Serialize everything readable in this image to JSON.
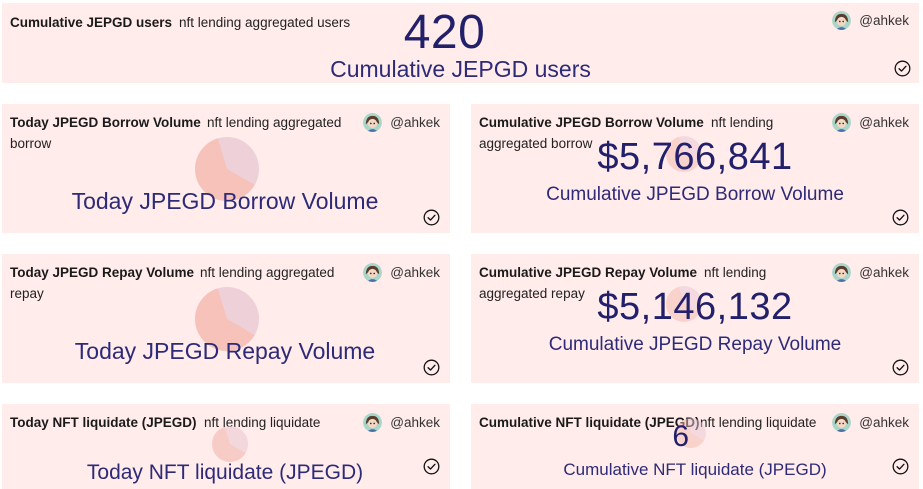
{
  "author": "@ahkek",
  "cards": {
    "c0": {
      "title": "Cumulative JEPGD users",
      "subtitle_line1": "nft lending aggregated users",
      "value": "420",
      "label": "Cumulative JEPGD users"
    },
    "c1": {
      "title": "Today JPEGD Borrow Volume",
      "subtitle_line1": "nft lending aggregated",
      "subtitle_line2": "borrow",
      "label": "Today JPEGD Borrow Volume"
    },
    "c2": {
      "title": "Cumulative JPEGD Borrow Volume",
      "subtitle_line1": "nft lending",
      "subtitle_line2": "aggregated borrow",
      "value": "$5,766,841",
      "label": "Cumulative JPEGD Borrow Volume"
    },
    "c3": {
      "title": "Today JPEGD Repay Volume",
      "subtitle_line1": "nft lending aggregated",
      "subtitle_line2": "repay",
      "label": "Today JPEGD Repay Volume"
    },
    "c4": {
      "title": "Cumulative JPEGD Repay Volume",
      "subtitle_line1": "nft lending",
      "subtitle_line2": "aggregated repay",
      "value": "$5,146,132",
      "label": "Cumulative JPEGD Repay Volume"
    },
    "c5": {
      "title": "Today NFT liquidate (JPEGD)",
      "subtitle_line1": "nft lending liquidate",
      "label": "Today NFT liquidate (JPEGD)"
    },
    "c6": {
      "title": "Cumulative NFT liquidate (JPEGD)",
      "subtitle_line1": "nft lending liquidate",
      "value": "6",
      "label": "Cumulative NFT liquidate (JPEGD)"
    }
  },
  "colors": {
    "card_bg": "#ffeceb",
    "value_text": "#23206b",
    "label_text": "#2d2a78"
  },
  "icons": {
    "avatar": "avatar-icon",
    "status": "check-circle-icon",
    "loading": "loading-spinner-icon"
  }
}
